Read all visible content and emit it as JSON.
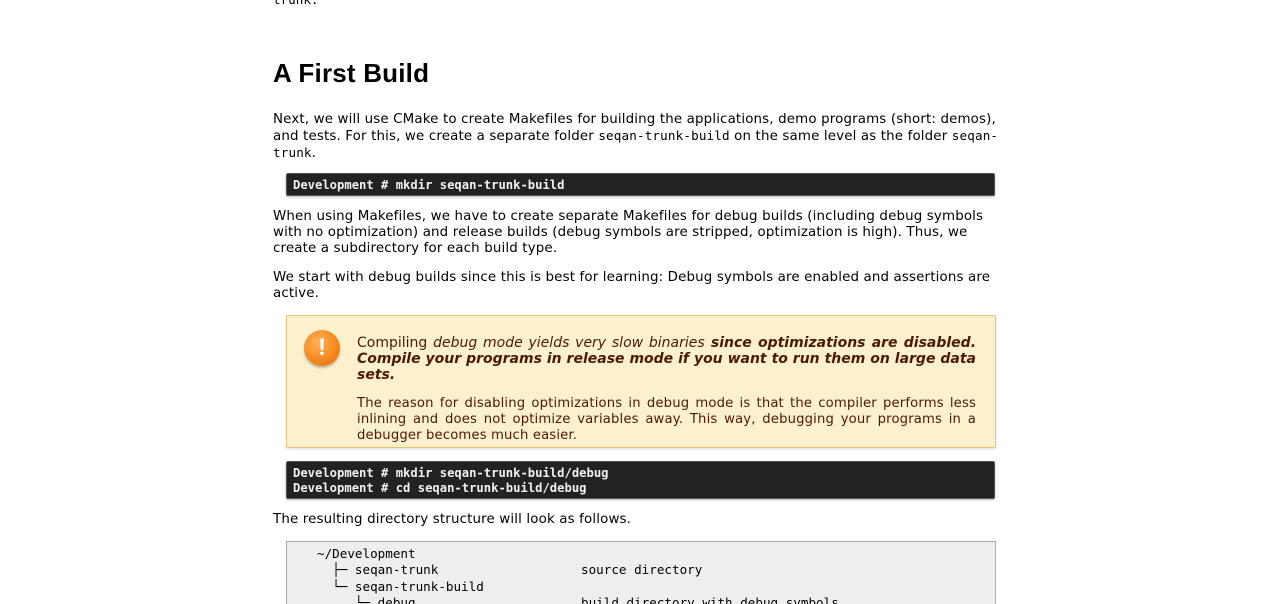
{
  "top_fragment": "trunk.",
  "heading": "A First Build",
  "para1": {
    "t1": "Next, we will use CMake to create Makefiles for building the applications, demo programs (short: demos), and tests. For this, we create a separate folder ",
    "c1": "seqan-trunk-build",
    "t2": " on the same level as the folder ",
    "c2": "seqan-trunk",
    "t3": "."
  },
  "cmd1": "Development # mkdir seqan-trunk-build",
  "para2": "When using Makefiles, we have to create separate Makefiles for debug builds (including debug symbols with no optimization) and release builds (debug symbols are stripped, optimization is high). Thus, we create a subdirectory for each build type.",
  "para3": "We start with debug builds since this is best for learning: Debug symbols are enabled and assertions are active.",
  "warning": {
    "icon_glyph": "!",
    "main_plain": "Compiling ",
    "main_em": "debug mode yields very slow binaries",
    "main_strong": " since optimizations are disabled. Compile your programs in release mode if you want to run them on large data sets.",
    "sub": "The reason for disabling optimizations in debug mode is that the compiler performs less inlining and does not optimize variables away. This way, debugging your programs in a debugger becomes much easier.",
    "colors": {
      "background": "#fcf1cc",
      "border": "#e6c47b",
      "text": "#4d1a00",
      "icon": "#f58a1f"
    }
  },
  "cmd2": [
    "Development # mkdir seqan-trunk-build/debug",
    "Development # cd seqan-trunk-build/debug"
  ],
  "para4": "The resulting directory structure will look as follows.",
  "tree": [
    {
      "name": "~/Development",
      "desc": ""
    },
    {
      "name": "  ├─ seqan-trunk",
      "desc": "source directory"
    },
    {
      "name": "  └─ seqan-trunk-build",
      "desc": ""
    },
    {
      "name": "     └─ debug",
      "desc": "build directory with debug symbols"
    }
  ]
}
